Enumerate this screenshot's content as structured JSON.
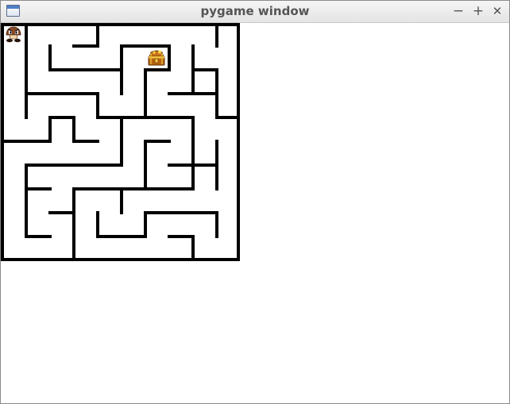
{
  "window": {
    "title": "pygame window",
    "minimize_glyph": "−",
    "maximize_glyph": "+",
    "close_glyph": "✕"
  },
  "game": {
    "wall_color": "#000000",
    "floor_color": "#ffffff",
    "player": {
      "icon": "goomba-sprite-icon",
      "cell": [
        0,
        0
      ]
    },
    "goal": {
      "icon": "treasure-chest-icon",
      "cell": [
        6,
        1
      ]
    }
  }
}
